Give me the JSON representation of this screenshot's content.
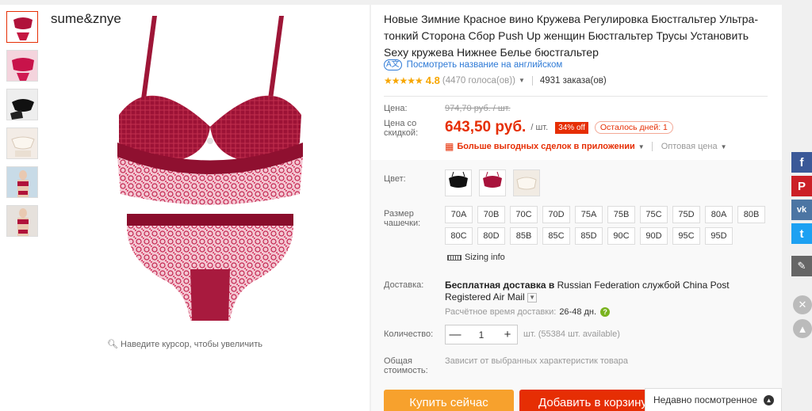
{
  "brand": "sume&znye",
  "zoom_hint": "Наведите курсор, чтобы увеличить",
  "thumbnails": [
    {
      "name": "thumb-1"
    },
    {
      "name": "thumb-2"
    },
    {
      "name": "thumb-3"
    },
    {
      "name": "thumb-4"
    },
    {
      "name": "thumb-5"
    },
    {
      "name": "thumb-6"
    }
  ],
  "product": {
    "title": "Новые Зимние Красное вино Кружева Регулировка Бюстгальтер Ультра-тонкий Сторона Сбор Push Up женщин Бюстгальтер Трусы Установить Sexy кружева Нижнее Белье бюстгальтер",
    "translate_link": "Посмотреть название на английском",
    "translate_icon": "A文",
    "stars": "★★★★★",
    "rating": "4.8",
    "votes": "(4470 голоса(ов))",
    "orders": "4931 заказа(ов)"
  },
  "price": {
    "old_label": "Цена:",
    "old_value": "974,70 руб. / шт.",
    "new_label": "Цена со скидкой:",
    "new_value": "643,50 руб.",
    "unit": "/ шт.",
    "discount": "34% off",
    "days_left": "Осталось дней: 1",
    "app_deals": "Больше выгодных сделок в приложении",
    "wholesale": "Оптовая цена"
  },
  "color": {
    "label": "Цвет:",
    "options": [
      "black",
      "wine-red",
      "beige"
    ]
  },
  "size": {
    "label": "Размер чашечки:",
    "options": [
      "70A",
      "70B",
      "70C",
      "70D",
      "75A",
      "75B",
      "75C",
      "75D",
      "80A",
      "80B",
      "80C",
      "80D",
      "85B",
      "85C",
      "85D",
      "90C",
      "90D",
      "95C",
      "95D"
    ],
    "sizing_info": "Sizing info"
  },
  "shipping": {
    "label": "Доставка:",
    "free_text": "Бесплатная доставка в",
    "country": "Russian Federation",
    "via": "службой",
    "carrier": "China Post Registered Air Mail",
    "est_label": "Расчётное время доставки:",
    "est_days": "26-48 дн."
  },
  "quantity": {
    "label": "Количество:",
    "value": "1",
    "minus": "—",
    "plus": "+",
    "available": "шт. (55384 шт. available)"
  },
  "total": {
    "label": "Общая стоимость:",
    "value": "Зависит от выбранных характеристик товара"
  },
  "buttons": {
    "buy_now": "Купить сейчас",
    "add_cart": "Добавить в корзину"
  },
  "recently_viewed": "Недавно посмотренное",
  "social": {
    "facebook": "f",
    "pinterest": "P",
    "vk": "vk",
    "twitter": "t"
  },
  "colors": {
    "accent": "#e62e04",
    "buy": "#f7a12d",
    "link": "#2e7ad6",
    "star": "#f7a600"
  }
}
